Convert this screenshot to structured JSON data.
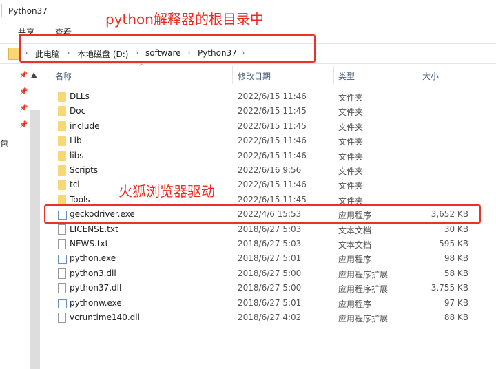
{
  "window": {
    "title": "Python37"
  },
  "ribbon": {
    "tabs": [
      "共享",
      "查看"
    ]
  },
  "address": {
    "crumbs": [
      "此电脑",
      "本地磁盘 (D:)",
      "software",
      "Python37"
    ]
  },
  "annotations": {
    "root": "python解释器的根目录中",
    "driver": "火狐浏览器驱动",
    "color": "#ee2a1e"
  },
  "sidebar": {
    "partial_label": "包"
  },
  "columns": {
    "name": "名称",
    "date": "修改日期",
    "type": "类型",
    "size": "大小"
  },
  "files": [
    {
      "name": "DLLs",
      "date": "2022/6/15 11:46",
      "type": "文件夹",
      "size": "",
      "icon": "folder"
    },
    {
      "name": "Doc",
      "date": "2022/6/15 11:45",
      "type": "文件夹",
      "size": "",
      "icon": "folder"
    },
    {
      "name": "include",
      "date": "2022/6/15 11:45",
      "type": "文件夹",
      "size": "",
      "icon": "folder"
    },
    {
      "name": "Lib",
      "date": "2022/6/15 11:46",
      "type": "文件夹",
      "size": "",
      "icon": "folder"
    },
    {
      "name": "libs",
      "date": "2022/6/15 11:46",
      "type": "文件夹",
      "size": "",
      "icon": "folder"
    },
    {
      "name": "Scripts",
      "date": "2022/6/16 9:56",
      "type": "文件夹",
      "size": "",
      "icon": "folder"
    },
    {
      "name": "tcl",
      "date": "2022/6/15 11:46",
      "type": "文件夹",
      "size": "",
      "icon": "folder"
    },
    {
      "name": "Tools",
      "date": "2022/6/15 11:45",
      "type": "文件夹",
      "size": "",
      "icon": "folder"
    },
    {
      "name": "geckodriver.exe",
      "date": "2022/4/6 15:53",
      "type": "应用程序",
      "size": "3,652 KB",
      "icon": "exe"
    },
    {
      "name": "LICENSE.txt",
      "date": "2018/6/27 5:03",
      "type": "文本文档",
      "size": "30 KB",
      "icon": "file"
    },
    {
      "name": "NEWS.txt",
      "date": "2018/6/27 5:03",
      "type": "文本文档",
      "size": "595 KB",
      "icon": "file"
    },
    {
      "name": "python.exe",
      "date": "2018/6/27 5:01",
      "type": "应用程序",
      "size": "98 KB",
      "icon": "exe"
    },
    {
      "name": "python3.dll",
      "date": "2018/6/27 5:00",
      "type": "应用程序扩展",
      "size": "58 KB",
      "icon": "file"
    },
    {
      "name": "python37.dll",
      "date": "2018/6/27 5:00",
      "type": "应用程序扩展",
      "size": "3,755 KB",
      "icon": "file"
    },
    {
      "name": "pythonw.exe",
      "date": "2018/6/27 5:01",
      "type": "应用程序",
      "size": "97 KB",
      "icon": "exe"
    },
    {
      "name": "vcruntime140.dll",
      "date": "2018/6/27 4:02",
      "type": "应用程序扩展",
      "size": "88 KB",
      "icon": "file"
    }
  ]
}
